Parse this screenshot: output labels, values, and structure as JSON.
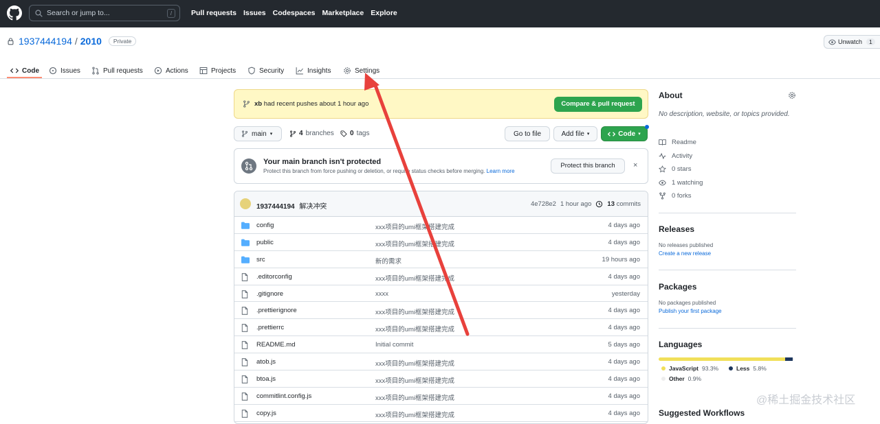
{
  "header": {
    "search_placeholder": "Search or jump to...",
    "search_shortcut": "/",
    "nav": [
      "Pull requests",
      "Issues",
      "Codespaces",
      "Marketplace",
      "Explore"
    ]
  },
  "repo": {
    "owner": "1937444194",
    "separator": "/",
    "name": "2010",
    "visibility": "Private",
    "unwatch_label": "Unwatch",
    "unwatch_count": "1"
  },
  "tabs": [
    "Code",
    "Issues",
    "Pull requests",
    "Actions",
    "Projects",
    "Security",
    "Insights",
    "Settings"
  ],
  "push_banner": {
    "user": "xb",
    "text": "had recent pushes about 1 hour ago",
    "button": "Compare & pull request"
  },
  "toolbar": {
    "branch": "main",
    "branches_count": "4",
    "branches_label": "branches",
    "tags_count": "0",
    "tags_label": "tags",
    "go_to_file": "Go to file",
    "add_file": "Add file",
    "code": "Code"
  },
  "protect": {
    "title": "Your main branch isn't protected",
    "desc": "Protect this branch from force pushing or deletion, or require status checks before merging.",
    "learn_more": "Learn more",
    "button": "Protect this branch",
    "close": "×"
  },
  "commit": {
    "author": "1937444194",
    "message": "解决冲突",
    "sha": "4e728e2",
    "time": "1 hour ago",
    "count": "13",
    "count_label": "commits"
  },
  "files": [
    {
      "name": "config",
      "type": "dir",
      "msg": "xxx项目的umi框架搭建完成",
      "age": "4 days ago"
    },
    {
      "name": "public",
      "type": "dir",
      "msg": "xxx项目的umi框架搭建完成",
      "age": "4 days ago"
    },
    {
      "name": "src",
      "type": "dir",
      "msg": "新的需求",
      "age": "19 hours ago"
    },
    {
      "name": ".editorconfig",
      "type": "file",
      "msg": "xxx项目的umi框架搭建完成",
      "age": "4 days ago"
    },
    {
      "name": ".gitignore",
      "type": "file",
      "msg": "xxxx",
      "age": "yesterday"
    },
    {
      "name": ".prettierignore",
      "type": "file",
      "msg": "xxx项目的umi框架搭建完成",
      "age": "4 days ago"
    },
    {
      "name": ".prettierrc",
      "type": "file",
      "msg": "xxx项目的umi框架搭建完成",
      "age": "4 days ago"
    },
    {
      "name": "README.md",
      "type": "file",
      "msg": "Initial commit",
      "age": "5 days ago"
    },
    {
      "name": "atob.js",
      "type": "file",
      "msg": "xxx项目的umi框架搭建完成",
      "age": "4 days ago"
    },
    {
      "name": "btoa.js",
      "type": "file",
      "msg": "xxx项目的umi框架搭建完成",
      "age": "4 days ago"
    },
    {
      "name": "commitlint.config.js",
      "type": "file",
      "msg": "xxx项目的umi框架搭建完成",
      "age": "4 days ago"
    },
    {
      "name": "copy.js",
      "type": "file",
      "msg": "xxx项目的umi框架搭建完成",
      "age": "4 days ago"
    }
  ],
  "about": {
    "title": "About",
    "desc": "No description, website, or topics provided.",
    "readme": "Readme",
    "activity": "Activity",
    "stars": "0 stars",
    "watching": "1 watching",
    "forks": "0 forks"
  },
  "releases": {
    "title": "Releases",
    "none": "No releases published",
    "link": "Create a new release"
  },
  "packages": {
    "title": "Packages",
    "none": "No packages published",
    "link": "Publish your first package"
  },
  "languages": {
    "title": "Languages",
    "items": [
      {
        "name": "JavaScript",
        "pct": "93.3%",
        "value": 93.3,
        "color": "#f1e05a"
      },
      {
        "name": "Less",
        "pct": "5.8%",
        "value": 5.8,
        "color": "#1d365d"
      },
      {
        "name": "Other",
        "pct": "0.9%",
        "value": 0.9,
        "color": "#ededed"
      }
    ]
  },
  "suggested": {
    "title": "Suggested Workflows"
  },
  "watermark": "@稀土掘金技术社区",
  "colors": {
    "accent": "#0969da",
    "green": "#2da44e",
    "banner": "#fff8c5",
    "arrow": "#e8413c"
  }
}
